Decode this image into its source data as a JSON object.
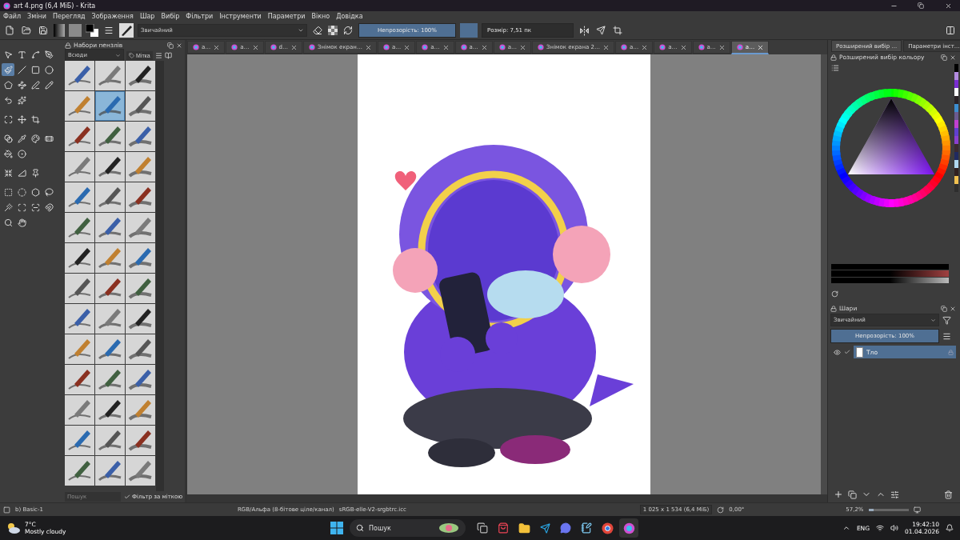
{
  "window": {
    "title": "art 4.png (6,4 МіБ)  - Krita"
  },
  "menu": [
    "Файл",
    "Зміни",
    "Перегляд",
    "Зображення",
    "Шар",
    "Вибір",
    "Фільтри",
    "Інструменти",
    "Параметри",
    "Вікно",
    "Довідка"
  ],
  "toolbar": {
    "blend_mode": "Звичайний",
    "opacity": {
      "label": "Непрозорість: 100%",
      "level": 1
    },
    "size": {
      "label": "Розмір: 7,51 пк"
    }
  },
  "tool_groups": [
    [
      {
        "kind": "pointer",
        "selected": false
      },
      {
        "kind": "text",
        "selected": false
      },
      {
        "kind": "edit-shapes",
        "selected": false
      },
      {
        "kind": "calligraphy",
        "selected": false
      },
      {
        "kind": "brush",
        "selected": true
      },
      {
        "kind": "line",
        "selected": false
      },
      {
        "kind": "rectangle",
        "selected": false
      },
      {
        "kind": "ellipse",
        "selected": false
      },
      {
        "kind": "polygon",
        "selected": false
      },
      {
        "kind": "polyline",
        "selected": false
      },
      {
        "kind": "bezier",
        "selected": false
      },
      {
        "kind": "freehand-path",
        "selected": false
      },
      {
        "kind": "dynamic-brush",
        "selected": false
      },
      {
        "kind": "multibrush",
        "selected": false
      }
    ],
    [
      {
        "kind": "transform",
        "selected": false
      },
      {
        "kind": "move",
        "selected": false
      },
      {
        "kind": "crop",
        "selected": false
      }
    ],
    [
      {
        "kind": "gradient",
        "selected": false
      },
      {
        "kind": "color-picker",
        "selected": false
      },
      {
        "kind": "colorize-mask",
        "selected": false
      },
      {
        "kind": "smart-patch",
        "selected": false
      },
      {
        "kind": "fill",
        "selected": false
      },
      {
        "kind": "enclosed-fill",
        "selected": false
      }
    ],
    [
      {
        "kind": "assistant",
        "selected": false
      },
      {
        "kind": "measure",
        "selected": false
      },
      {
        "kind": "reference",
        "selected": false
      }
    ],
    [
      {
        "kind": "rect-select",
        "selected": false
      },
      {
        "kind": "ellipse-select",
        "selected": false
      },
      {
        "kind": "polygon-select",
        "selected": false
      },
      {
        "kind": "freehand-select",
        "selected": false
      },
      {
        "kind": "contiguous-select",
        "selected": false
      },
      {
        "kind": "similar-select",
        "selected": false
      },
      {
        "kind": "bezier-select",
        "selected": false
      },
      {
        "kind": "magnetic-select",
        "selected": false
      },
      {
        "kind": "zoom",
        "selected": false
      },
      {
        "kind": "pan",
        "selected": false
      }
    ]
  ],
  "brush_presets": {
    "title": "Набори пензлів",
    "filter": "Всюди",
    "tag_button": "Мітка",
    "items": [
      {
        "selected": false
      },
      {
        "selected": false
      },
      {
        "selected": false
      },
      {
        "selected": false
      },
      {
        "selected": true
      },
      {
        "selected": false
      },
      {
        "selected": false
      },
      {
        "selected": false
      },
      {
        "selected": false
      },
      {
        "selected": false
      },
      {
        "selected": false
      },
      {
        "selected": false
      },
      {
        "selected": false
      },
      {
        "selected": false
      },
      {
        "selected": false
      },
      {
        "selected": false
      },
      {
        "selected": false
      },
      {
        "selected": false
      },
      {
        "selected": false
      },
      {
        "selected": false
      },
      {
        "selected": false
      },
      {
        "selected": false
      },
      {
        "selected": false
      },
      {
        "selected": false
      },
      {
        "selected": false
      },
      {
        "selected": false
      },
      {
        "selected": false
      },
      {
        "selected": false
      },
      {
        "selected": false
      },
      {
        "selected": false
      },
      {
        "selected": false
      },
      {
        "selected": false
      },
      {
        "selected": false
      },
      {
        "selected": false
      },
      {
        "selected": false
      },
      {
        "selected": false
      },
      {
        "selected": false
      },
      {
        "selected": false
      },
      {
        "selected": false
      },
      {
        "selected": false
      },
      {
        "selected": false
      },
      {
        "selected": false
      }
    ],
    "search": {
      "placeholder": "Пошук"
    },
    "tag_filter": {
      "label": "Фільтр за міткою",
      "checked": true
    }
  },
  "document_tabs": [
    {
      "label": "a…",
      "selected": false
    },
    {
      "label": "a…",
      "selected": false
    },
    {
      "label": "d…",
      "selected": false
    },
    {
      "label": "Знімок екран…",
      "selected": false
    },
    {
      "label": "a…",
      "selected": false
    },
    {
      "label": "a…",
      "selected": false
    },
    {
      "label": "a…",
      "selected": false
    },
    {
      "label": "a…",
      "selected": false
    },
    {
      "label": "Знімок екрана 2…",
      "selected": false
    },
    {
      "label": "a…",
      "selected": false
    },
    {
      "label": "a…",
      "selected": false
    },
    {
      "label": "a…",
      "selected": false
    },
    {
      "label": "a…",
      "selected": true
    }
  ],
  "right_tabs": [
    {
      "label": "Розширений вибір ...",
      "selected": true
    },
    {
      "label": "Параметри інст...",
      "selected": false
    }
  ],
  "color_selector": {
    "title": "Розширений вибір кольору",
    "swatches": [
      {
        "color": "#000000"
      },
      {
        "color": "#b28be0"
      },
      {
        "color": "#7a2dd0"
      },
      {
        "color": "#ffffff"
      },
      {
        "color": "#2a2226"
      },
      {
        "color": "#3c8ed0"
      },
      {
        "color": "#6a5a90"
      },
      {
        "color": "#c040d0"
      },
      {
        "color": "#6040d0"
      },
      {
        "color": "#8a40d0"
      },
      {
        "color": "#3a2a30"
      },
      {
        "color": "#202a60"
      },
      {
        "color": "#b0d8f0"
      },
      {
        "color": "#302020"
      },
      {
        "color": "#f0c050"
      },
      {
        "color": "#2e2e2e"
      }
    ]
  },
  "layers": {
    "title": "Шари",
    "blend_mode": "Звичайний",
    "opacity": {
      "label": "Непрозорість:  100%",
      "level": 1
    },
    "items": [
      {
        "name": "Тло",
        "visible": true,
        "checked": true,
        "selected": true
      }
    ]
  },
  "status_bar": {
    "brush": "b) Basic-1",
    "color_space": "RGB/Альфа (8-бітове ціле/канал)",
    "profile": "sRGB-elle-V2-srgbtrc.icc",
    "image_size": "1 025 x 1 534 (6,4 МіБ)",
    "rotation": "0,00°",
    "zoom": "57,2%",
    "zoom_slider": {
      "level": 0.12
    }
  },
  "taskbar": {
    "weather": {
      "temperature": "7°C",
      "condition": "Mostly cloudy"
    },
    "search": {
      "placeholder": "Пошук"
    },
    "language": "ENG",
    "time": "19:42:10",
    "date": "01.04.2026"
  }
}
